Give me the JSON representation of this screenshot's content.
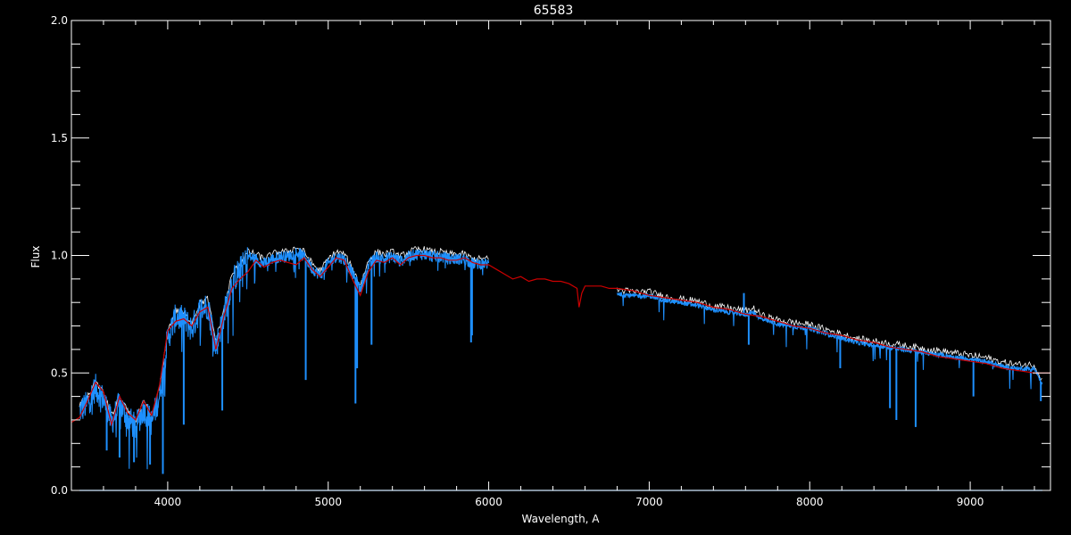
{
  "chart_data": {
    "type": "line",
    "title": "65583",
    "xlabel": "Wavelength, A",
    "ylabel": "Flux",
    "xlim": [
      3400,
      9500
    ],
    "ylim": [
      0.0,
      2.0
    ],
    "x_ticks": [
      4000,
      5000,
      6000,
      7000,
      8000,
      9000
    ],
    "x_tick_labels": [
      "4000",
      "5000",
      "6000",
      "7000",
      "8000",
      "9000"
    ],
    "y_ticks": [
      0.0,
      0.5,
      1.0,
      1.5,
      2.0
    ],
    "y_tick_labels": [
      "0.0",
      "0.5",
      "1.0",
      "1.5",
      "2.0"
    ],
    "grid": false,
    "colors": {
      "background": "#000000",
      "axes": "#ffffff",
      "model": "#cc0000",
      "observed": "#1e90ff",
      "observed_white": "#ffffff",
      "error": "#1e90ff"
    },
    "series": [
      {
        "role": "model",
        "color": "#cc0000",
        "x": [
          3400,
          3450,
          3500,
          3550,
          3600,
          3650,
          3700,
          3750,
          3800,
          3850,
          3900,
          3950,
          4000,
          4050,
          4100,
          4150,
          4200,
          4250,
          4300,
          4350,
          4400,
          4450,
          4500,
          4550,
          4600,
          4650,
          4700,
          4750,
          4800,
          4850,
          4900,
          4950,
          5000,
          5050,
          5100,
          5150,
          5200,
          5250,
          5300,
          5350,
          5400,
          5450,
          5500,
          5550,
          5600,
          5650,
          5700,
          5750,
          5800,
          5850,
          5900,
          5950,
          6000,
          6050,
          6100,
          6150,
          6200,
          6250,
          6300,
          6350,
          6400,
          6450,
          6500,
          6550,
          6563,
          6580,
          6600,
          6650,
          6700,
          6750,
          6800,
          6900,
          7000,
          7100,
          7200,
          7300,
          7400,
          7500,
          7600,
          7700,
          7800,
          7900,
          8000,
          8100,
          8200,
          8300,
          8400,
          8500,
          8600,
          8700,
          8800,
          8900,
          9000,
          9100,
          9200,
          9300,
          9400,
          9500
        ],
        "y": [
          0.29,
          0.31,
          0.38,
          0.46,
          0.42,
          0.28,
          0.4,
          0.33,
          0.3,
          0.38,
          0.32,
          0.45,
          0.68,
          0.72,
          0.73,
          0.7,
          0.76,
          0.78,
          0.6,
          0.74,
          0.86,
          0.9,
          0.93,
          0.98,
          0.95,
          0.97,
          0.98,
          0.97,
          0.96,
          0.99,
          0.94,
          0.91,
          0.95,
          0.99,
          0.98,
          0.9,
          0.83,
          0.93,
          0.98,
          0.97,
          0.99,
          0.96,
          0.99,
          1.0,
          1.0,
          0.99,
          0.99,
          0.98,
          0.98,
          0.99,
          0.97,
          0.96,
          0.96,
          0.94,
          0.92,
          0.9,
          0.91,
          0.89,
          0.9,
          0.9,
          0.89,
          0.89,
          0.88,
          0.86,
          0.78,
          0.84,
          0.87,
          0.87,
          0.87,
          0.86,
          0.86,
          0.85,
          0.83,
          0.82,
          0.81,
          0.8,
          0.78,
          0.77,
          0.75,
          0.74,
          0.72,
          0.7,
          0.69,
          0.67,
          0.66,
          0.64,
          0.63,
          0.61,
          0.6,
          0.59,
          0.57,
          0.56,
          0.55,
          0.54,
          0.52,
          0.51,
          0.5,
          0.5
        ]
      },
      {
        "role": "observed",
        "color": "#1e90ff",
        "segments": [
          {
            "x": [
              3450,
              3500,
              3550,
              3600,
              3650,
              3700,
              3750,
              3800,
              3850,
              3900,
              3950,
              4000,
              4050,
              4100,
              4150,
              4200,
              4250,
              4300,
              4350,
              4400,
              4450,
              4500,
              4550,
              4600,
              4650,
              4700,
              4750,
              4800,
              4850,
              4900,
              4950,
              5000,
              5050,
              5100,
              5150,
              5200,
              5250,
              5300,
              5350,
              5400,
              5450,
              5500,
              5550,
              5600,
              5650,
              5700,
              5750,
              5800,
              5850,
              5900,
              5950,
              6000
            ],
            "y": [
              0.35,
              0.38,
              0.45,
              0.4,
              0.3,
              0.38,
              0.32,
              0.28,
              0.36,
              0.3,
              0.42,
              0.66,
              0.75,
              0.74,
              0.7,
              0.78,
              0.8,
              0.62,
              0.76,
              0.9,
              0.95,
              1.0,
              0.99,
              0.97,
              0.99,
              1.0,
              1.0,
              1.02,
              1.0,
              0.95,
              0.92,
              0.97,
              1.0,
              0.99,
              0.93,
              0.86,
              0.96,
              1.0,
              0.99,
              1.0,
              0.98,
              1.0,
              1.01,
              1.01,
              1.0,
              1.0,
              0.99,
              0.99,
              0.99,
              0.97,
              0.97,
              0.97
            ],
            "dips": [
              [
                3620,
                0.17
              ],
              [
                3700,
                0.14
              ],
              [
                3790,
                0.12
              ],
              [
                3890,
                0.11
              ],
              [
                3970,
                0.07
              ],
              [
                4100,
                0.28
              ],
              [
                4340,
                0.34
              ],
              [
                4860,
                0.47
              ],
              [
                5170,
                0.37
              ],
              [
                5180,
                0.52
              ],
              [
                5270,
                0.62
              ],
              [
                5890,
                0.63
              ],
              [
                5896,
                0.66
              ]
            ]
          },
          {
            "x": [
              6800,
              6900,
              7000,
              7100,
              7200,
              7300,
              7400,
              7500,
              7600,
              7650,
              7700,
              7800,
              7900,
              8000,
              8100,
              8200,
              8300,
              8400,
              8500,
              8600,
              8700,
              8800,
              8900,
              9000,
              9100,
              9200,
              9300,
              9400,
              9450
            ],
            "y": [
              0.84,
              0.83,
              0.83,
              0.81,
              0.8,
              0.79,
              0.77,
              0.76,
              0.75,
              0.76,
              0.73,
              0.71,
              0.7,
              0.69,
              0.67,
              0.65,
              0.63,
              0.62,
              0.61,
              0.6,
              0.59,
              0.58,
              0.57,
              0.56,
              0.55,
              0.53,
              0.52,
              0.52,
              0.45
            ],
            "dips": [
              [
                7590,
                0.84
              ],
              [
                7620,
                0.62
              ],
              [
                8190,
                0.52
              ],
              [
                8500,
                0.35
              ],
              [
                8540,
                0.3
              ],
              [
                8660,
                0.27
              ],
              [
                9020,
                0.4
              ],
              [
                9440,
                0.38
              ]
            ]
          }
        ]
      },
      {
        "role": "error",
        "color": "#1e90ff",
        "x": [
          3450,
          9450
        ],
        "y": [
          0.0,
          0.0
        ]
      }
    ]
  }
}
